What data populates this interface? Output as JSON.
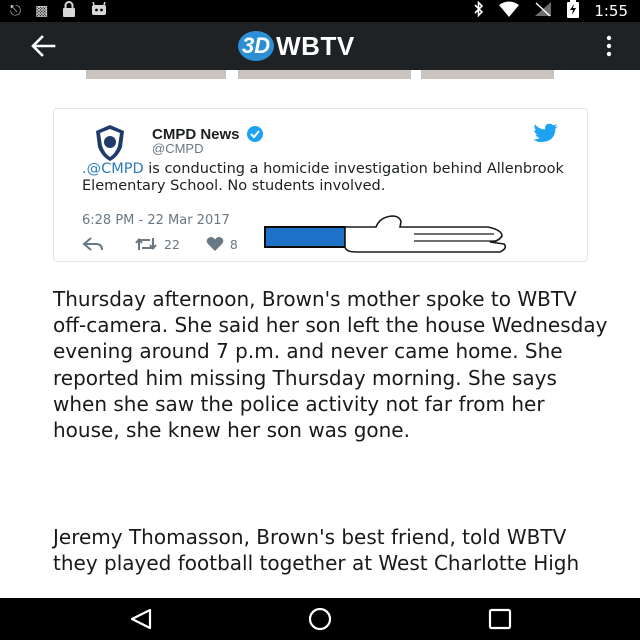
{
  "status_bar": {
    "time": "1:55",
    "icons_left": [
      "sync-icon",
      "no-sim-icon",
      "lock-icon",
      "android-debug-icon"
    ],
    "icons_right": [
      "bluetooth-icon",
      "wifi-icon",
      "signal-off-icon",
      "battery-charging-icon"
    ]
  },
  "app_bar": {
    "brand_3d": "3D",
    "brand_name": "WBTV",
    "brand_color": "#2b8fd6",
    "background": "#1f2224"
  },
  "tweet": {
    "author": "CMPD News",
    "handle": "@CMPD",
    "mention": ".@CMPD",
    "body": " is conducting a homicide investigation behind Allenbrook Elementary School. No students involved.",
    "timestamp": "6:28 PM - 22 Mar 2017",
    "retweets": "22",
    "likes": "8",
    "link_color": "#2b7bb9"
  },
  "article": {
    "paragraph1": "Thursday afternoon, Brown's mother spoke to WBTV off-camera. She said her son left the house Wednesday evening around 7 p.m. and never came home. She reported him missing Thursday morning. She says when she saw the police activity not far from her house, she knew her son was gone.",
    "paragraph2": "Jeremy Thomasson, Brown's best friend, told WBTV they played football together at West Charlotte High"
  },
  "nav_bar": {
    "buttons": [
      "nav-back-icon",
      "nav-home-icon",
      "nav-recents-icon"
    ]
  }
}
